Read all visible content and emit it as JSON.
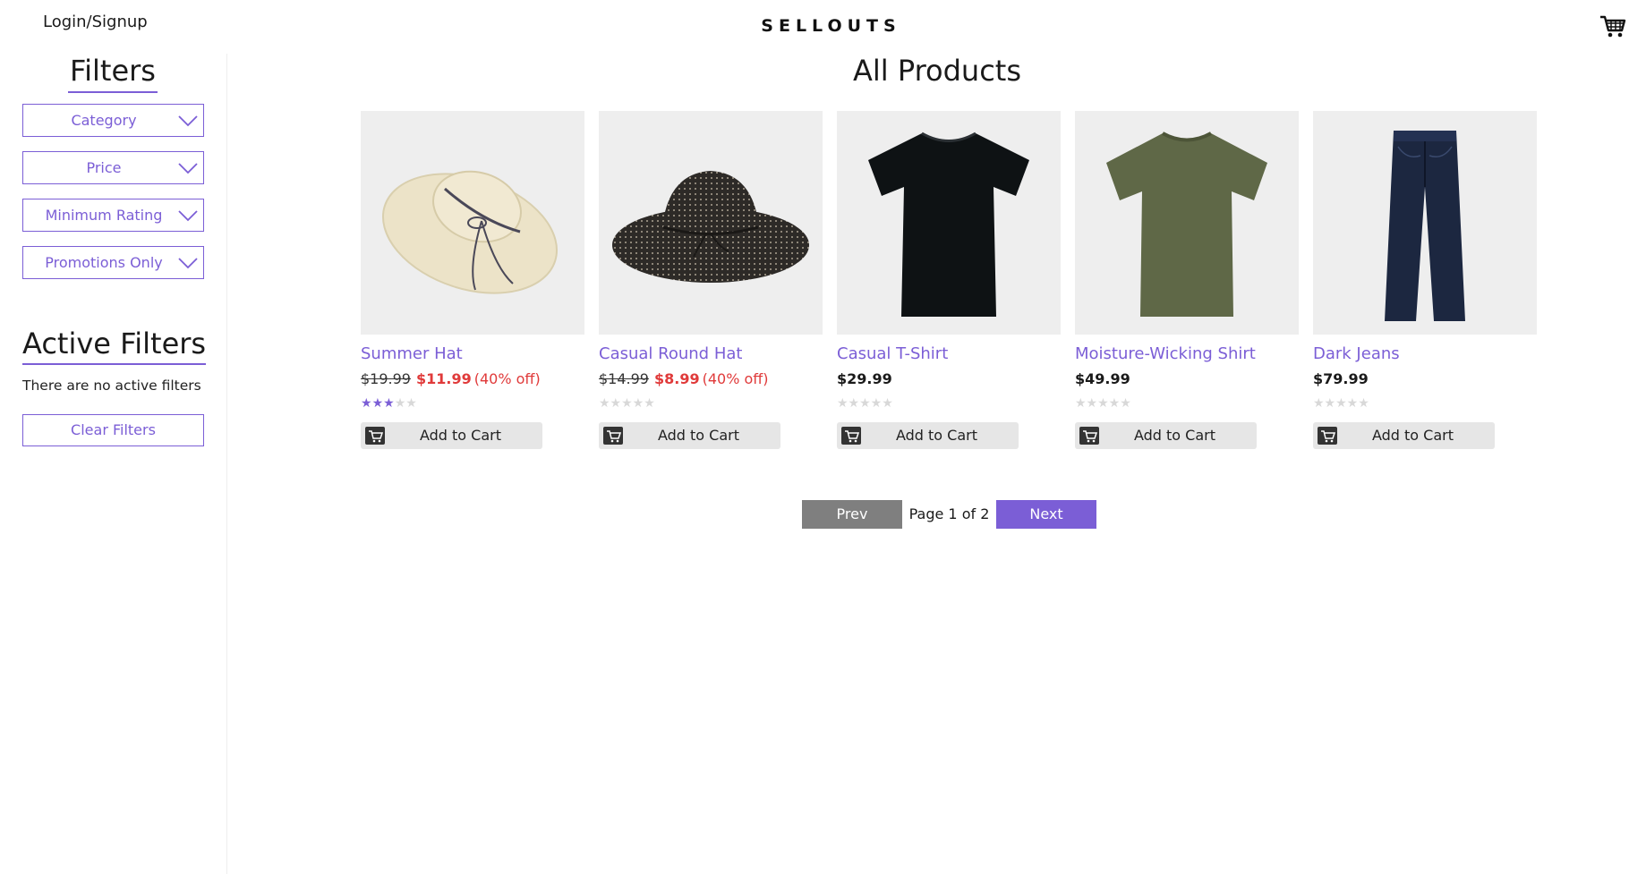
{
  "header": {
    "login_label": "Login/Signup",
    "brand": "SELLOUTS",
    "cart_icon": "cart-icon"
  },
  "sidebar": {
    "filters_title": "Filters",
    "dropdowns": [
      {
        "label": "Category"
      },
      {
        "label": "Price"
      },
      {
        "label": "Minimum Rating"
      },
      {
        "label": "Promotions Only"
      }
    ],
    "active_title": "Active Filters",
    "no_filters_text": "There are no active filters",
    "clear_label": "Clear Filters"
  },
  "main": {
    "title": "All Products",
    "products": [
      {
        "name": "Summer Hat",
        "old_price": "$19.99",
        "price": "$11.99",
        "discount": "(40% off)",
        "rating": 3,
        "add_label": "Add to Cart",
        "image": "summer-hat"
      },
      {
        "name": "Casual Round Hat",
        "old_price": "$14.99",
        "price": "$8.99",
        "discount": "(40% off)",
        "rating": 0,
        "add_label": "Add to Cart",
        "image": "round-hat"
      },
      {
        "name": "Casual T-Shirt",
        "old_price": "",
        "price": "$29.99",
        "discount": "",
        "rating": 0,
        "add_label": "Add to Cart",
        "image": "black-tshirt"
      },
      {
        "name": "Moisture-Wicking Shirt",
        "old_price": "",
        "price": "$49.99",
        "discount": "",
        "rating": 0,
        "add_label": "Add to Cart",
        "image": "green-shirt"
      },
      {
        "name": "Dark Jeans",
        "old_price": "",
        "price": "$79.99",
        "discount": "",
        "rating": 0,
        "add_label": "Add to Cart",
        "image": "dark-jeans"
      }
    ]
  },
  "pagination": {
    "prev_label": "Prev",
    "page_info": "Page 1 of 2",
    "next_label": "Next"
  },
  "colors": {
    "accent": "#7b5ed6",
    "sale": "#e03a3a",
    "prev_bg": "#7f7f7f"
  }
}
